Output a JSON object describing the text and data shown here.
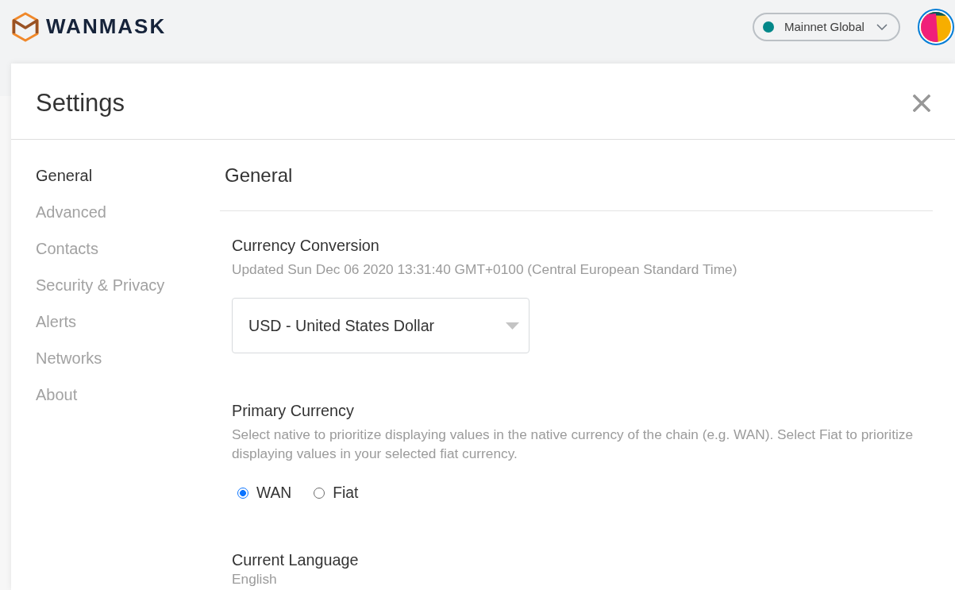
{
  "header": {
    "logo_text": "WANMASK",
    "network": {
      "label": "Mainnet Global"
    }
  },
  "settings": {
    "title": "Settings",
    "sidebar": {
      "items": [
        {
          "label": "General",
          "selected": true
        },
        {
          "label": "Advanced",
          "selected": false
        },
        {
          "label": "Contacts",
          "selected": false
        },
        {
          "label": "Security & Privacy",
          "selected": false
        },
        {
          "label": "Alerts",
          "selected": false
        },
        {
          "label": "Networks",
          "selected": false
        },
        {
          "label": "About",
          "selected": false
        }
      ]
    },
    "content": {
      "heading": "General",
      "sections": [
        {
          "kind": "dropdown",
          "title": "Currency Conversion",
          "description": "Updated Sun Dec 06 2020 13:31:40 GMT+0100 (Central European Standard Time)",
          "value": "USD - United States Dollar"
        },
        {
          "kind": "radio",
          "title": "Primary Currency",
          "description": "Select native to prioritize displaying values in the native currency of the chain (e.g. WAN). Select Fiat to prioritize displaying values in your selected fiat currency.",
          "options": [
            {
              "label": "WAN",
              "selected": true
            },
            {
              "label": "Fiat",
              "selected": false
            }
          ]
        },
        {
          "kind": "text",
          "title": "Current Language",
          "value": "English"
        }
      ]
    }
  }
}
